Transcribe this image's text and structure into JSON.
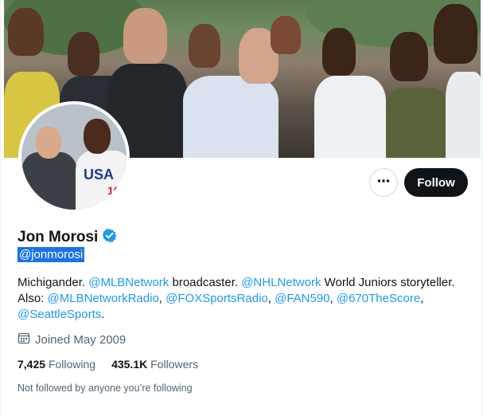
{
  "profile": {
    "name": "Jon Morosi",
    "handle": "@jonmorosi",
    "verified": true
  },
  "actions": {
    "more_icon": "more-horizontal-icon",
    "follow_label": "Follow"
  },
  "bio": {
    "part1": "Michigander. ",
    "link1": "@MLBNetwork",
    "part2": " broadcaster. ",
    "link2": "@NHLNetwork",
    "part3": " World Juniors storyteller. Also: ",
    "link3": "@MLBNetworkRadio",
    "sep1": ", ",
    "link4": "@FOXSportsRadio",
    "sep2": ", ",
    "link5": "@FAN590",
    "sep3": ", ",
    "link6": "@670TheScore",
    "sep4": ", ",
    "link7": "@SeattleSports",
    "end": "."
  },
  "joined": {
    "icon": "calendar-icon",
    "text": "Joined May 2009"
  },
  "stats": {
    "following_count": "7,425",
    "following_label": "Following",
    "followers_count": "435.1K",
    "followers_label": "Followers"
  },
  "followed_note": "Not followed by anyone you’re following",
  "colors": {
    "link": "#1d9bf0",
    "verified": "#1d9bf0",
    "follow_bg": "#0f1419",
    "muted": "#536471"
  }
}
